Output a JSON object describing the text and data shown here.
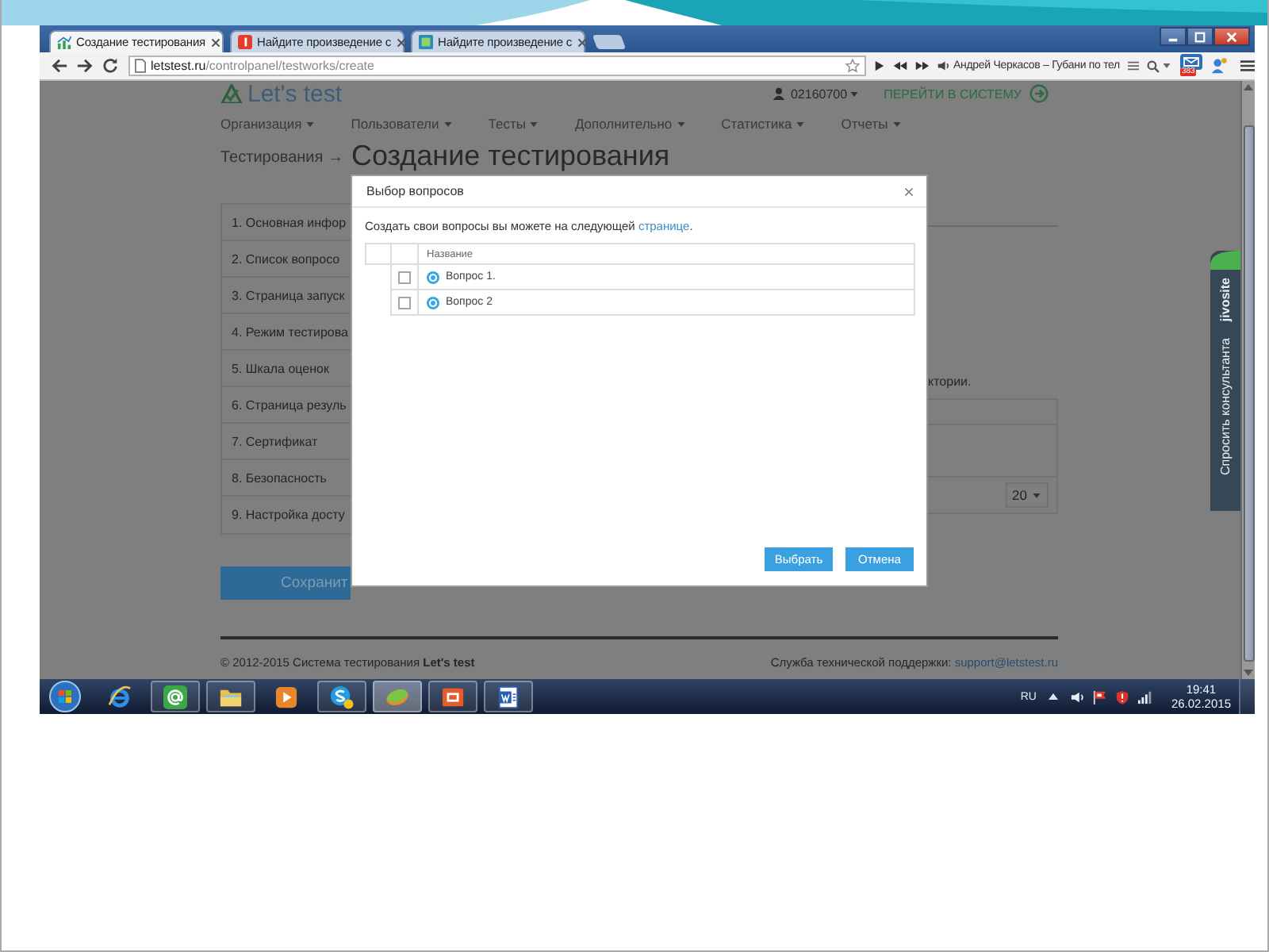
{
  "browser": {
    "tabs": [
      {
        "kind": "chart",
        "title": "Создание тестирования",
        "selected": true
      },
      {
        "kind": "search",
        "title": "Найдите произведение с",
        "selected": false
      },
      {
        "kind": "page",
        "title": "Найдите произведение с",
        "selected": false
      }
    ],
    "address": {
      "host": "letstest.ru",
      "path": "/controlpanel/testworks/create"
    },
    "player": {
      "track": "Андрей Черкасов – Губани по тел"
    },
    "badge": "383"
  },
  "page": {
    "logo": "Let's test",
    "user": "02160700",
    "login_link": "ПЕРЕЙТИ В СИСТЕМУ",
    "menu": [
      "Организация",
      "Пользователи",
      "Тесты",
      "Дополнительно",
      "Статистика",
      "Отчеты"
    ],
    "breadcrumb": "Тестирования →",
    "title": "Создание тестирования",
    "steps": [
      "1. Основная инфор",
      "2. Список вопросо",
      "3. Страница запуск",
      "4. Режим тестирова",
      "5. Шкала оценок",
      "6. Страница резуль",
      "7. Сертификат",
      "8. Безопасность",
      "9. Настройка досту"
    ],
    "save_button": "Сохранит",
    "note_fragment": "ктории.",
    "page_size": "20",
    "footer": {
      "copyright": "© 2012-2015 Система тестирования **Let's test**",
      "support_label": "Служба технической поддержки:",
      "support_email": "support@letstest.ru"
    }
  },
  "chat_widget": {
    "brand": "jivosite",
    "label": "Спросить консультанта"
  },
  "dialog": {
    "title": "Выбор вопросов",
    "intro": "Создать свои вопросы вы можете на следующей",
    "link": "странице",
    "intro_end": ".",
    "column": "Название",
    "rows": [
      {
        "name": "Вопрос 1.",
        "checked": false
      },
      {
        "name": "Вопрос 2",
        "checked": false
      }
    ],
    "buttons": [
      "Выбрать",
      "Отмена"
    ]
  },
  "taskbar": {
    "apps": [
      {
        "kind": "browser",
        "running": false,
        "active": false
      },
      {
        "kind": "mail",
        "running": true,
        "active": false
      },
      {
        "kind": "folder",
        "running": true,
        "active": false
      },
      {
        "kind": "player",
        "running": false,
        "active": false
      },
      {
        "kind": "messenger",
        "running": true,
        "active": false
      },
      {
        "kind": "disc",
        "running": true,
        "active": true
      },
      {
        "kind": "slides",
        "running": true,
        "active": false
      },
      {
        "kind": "document",
        "running": true,
        "active": false
      }
    ],
    "language": "RU",
    "time": "19:41",
    "date": "26.02.2015"
  }
}
